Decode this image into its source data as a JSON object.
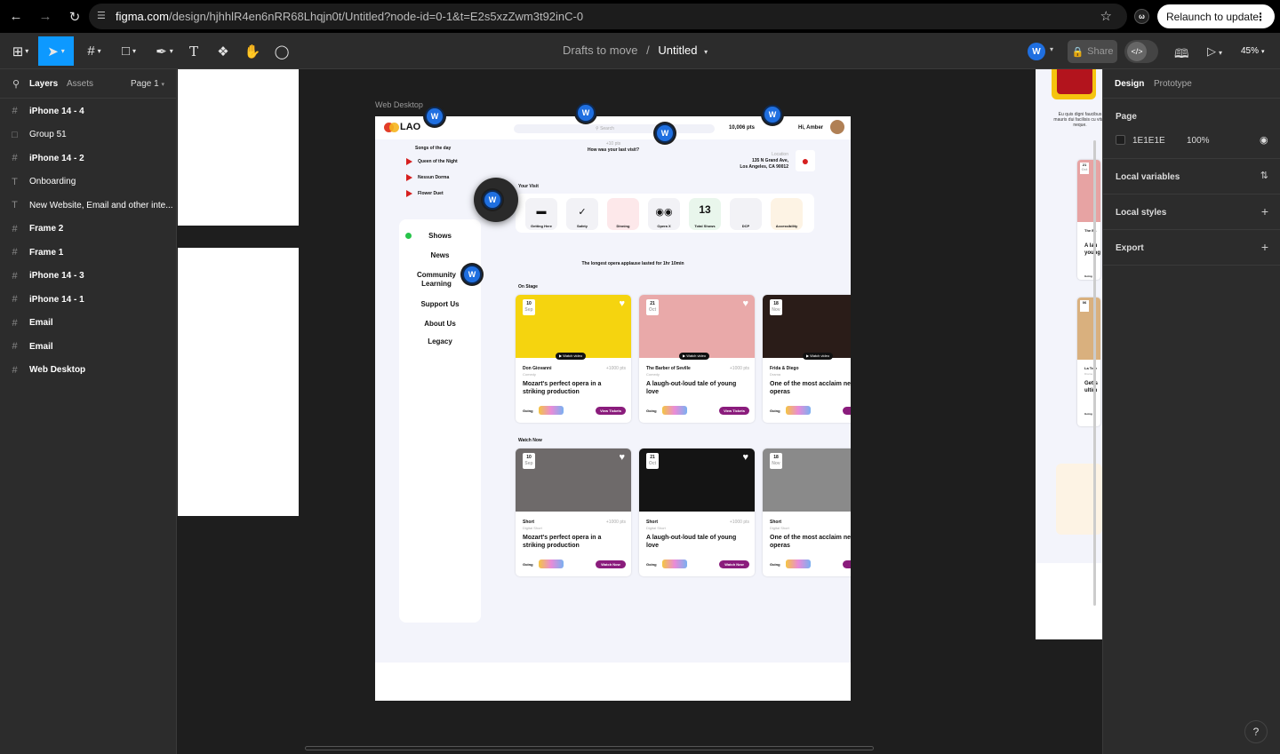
{
  "browser": {
    "url_host": "figma.com",
    "url_path": "/design/hjhhlR4en6nRR68Lhqjn0t/Untitled?node-id=0-1&t=E2s5xzZwm3t92inC-0",
    "relaunch_label": "Relaunch to update"
  },
  "toolbar": {
    "breadcrumb": "Drafts to move",
    "separator": "/",
    "file_title": "Untitled",
    "avatar_letter": "W",
    "share_label": "Share",
    "zoom": "45%"
  },
  "left_panel": {
    "tab_layers": "Layers",
    "tab_assets": "Assets",
    "page_label": "Page 1",
    "layers": [
      {
        "name": "iPhone 14 - 4",
        "icon": "frame-icon"
      },
      {
        "name": "Group 51",
        "icon": "group-icon"
      },
      {
        "name": "iPhone 14 - 2",
        "icon": "frame-icon"
      },
      {
        "name": "Onboarding",
        "icon": "text-icon"
      },
      {
        "name": "New Website, Email and other inte...",
        "icon": "text-icon"
      },
      {
        "name": "Frame 2",
        "icon": "frame-icon"
      },
      {
        "name": "Frame 1",
        "icon": "frame-icon"
      },
      {
        "name": "iPhone 14 - 3",
        "icon": "frame-icon"
      },
      {
        "name": "iPhone 14 - 1",
        "icon": "frame-icon"
      },
      {
        "name": "Email",
        "icon": "frame-icon"
      },
      {
        "name": "Email",
        "icon": "frame-icon"
      },
      {
        "name": "Web Desktop",
        "icon": "frame-icon"
      }
    ]
  },
  "right_panel": {
    "tab_design": "Design",
    "tab_prototype": "Prototype",
    "page_heading": "Page",
    "page_color": "1E1E1E",
    "page_opacity": "100%",
    "local_variables": "Local variables",
    "local_styles": "Local styles",
    "export": "Export"
  },
  "canvas": {
    "frame_label": "Web Desktop",
    "right_frame_text": "Eu quis digni faucibus mauris dui facilisis cu vitae neque.",
    "right_card1_date_day": "21",
    "right_card1_date_month": "Oct",
    "right_card1_title": "The Ba",
    "right_card1_desc": "A lau young",
    "right_card1_going": "Going",
    "right_card2_date_day": "06",
    "right_card2_title": "La Trav",
    "right_card2_desc": "Get s ultim",
    "right_card2_going": "Going",
    "right_card2_genre": "Drama"
  },
  "site": {
    "logo": "LAO",
    "search_placeholder": "Search",
    "points": "10,006 pts",
    "greeting": "Hi, Amber",
    "songs_title": "Songs of the day",
    "songs": [
      "Queen of the Night",
      "Nessun Dorma",
      "Flower Duet"
    ],
    "visit_pts": "+10 pts",
    "visit_question": "How was your last visit?",
    "location_label": "Location",
    "location_line1": "135 N Grand Ave,",
    "location_line2": "Los Angeles, CA 90012",
    "your_visit": "Your Visit",
    "visit_tiles": [
      {
        "label": "Getting Here",
        "icon": "car-icon",
        "bg": "#f2f2f6"
      },
      {
        "label": "Safety",
        "icon": "shield-check-icon",
        "bg": "#f2f2f6"
      },
      {
        "label": "Dinning",
        "icon": "",
        "bg": "#fde8ea"
      },
      {
        "label": "Opera X",
        "icon": "glasses-icon",
        "bg": "#f2f2f6"
      },
      {
        "label": "Total Shows",
        "icon": "13",
        "bg": "#e9f6ec"
      },
      {
        "label": "DCP",
        "icon": "",
        "bg": "#f2f2f6"
      },
      {
        "label": "Accessibility",
        "icon": "",
        "bg": "#fdf3e4"
      }
    ],
    "nav": [
      "Shows",
      "News",
      "Community Learning",
      "Support Us",
      "About Us",
      "Legacy"
    ],
    "fact": "The longest opera applause lasted for 1hr 10min",
    "on_stage_title": "On Stage",
    "watch_now_title": "Watch Now",
    "on_stage": [
      {
        "day": "10",
        "month": "Sep",
        "title": "Don Giovanni",
        "pts": "+1000 pts",
        "genre": "Comedy",
        "desc": "Mozart's perfect opera in a striking production",
        "going": "Going",
        "button": "View Tickets",
        "watch": "Watch video",
        "color": "#f5d40f"
      },
      {
        "day": "21",
        "month": "Oct",
        "title": "The Barber of Seville",
        "pts": "+1000 pts",
        "genre": "Comedy",
        "desc": "A laugh-out-loud tale of young love",
        "going": "Going",
        "button": "View Tickets",
        "watch": "Watch video",
        "color": "#e9a9a9"
      },
      {
        "day": "18",
        "month": "Nov",
        "title": "Frida & Diego",
        "pts": "+1",
        "genre": "Drama",
        "desc": "One of the most acclaim new operas",
        "going": "Going",
        "button": "Vie",
        "watch": "Watch video",
        "color": "#2a1c18"
      }
    ],
    "watch_now": [
      {
        "day": "10",
        "month": "Sep",
        "title": "Short",
        "pts": "+1000 pts",
        "genre": "Digital Short",
        "desc": "Mozart's perfect opera in a striking production",
        "going": "Going",
        "button": "Watch Now",
        "color": "#6e6a6a"
      },
      {
        "day": "21",
        "month": "Oct",
        "title": "Short",
        "pts": "+1000 pts",
        "genre": "Digital Short",
        "desc": "A laugh-out-loud tale of young love",
        "going": "Going",
        "button": "Watch Now",
        "color": "#141414"
      },
      {
        "day": "18",
        "month": "Nov",
        "title": "Short",
        "pts": "+1",
        "genre": "Digital Short",
        "desc": "One of the most acclaim new operas",
        "going": "Going",
        "button": "Wa",
        "color": "#8a8a8a"
      }
    ]
  },
  "colors": {
    "accent": "#0d99ff",
    "brand": "#8a1c7c",
    "canvas_bg": "#1e1e1e"
  }
}
